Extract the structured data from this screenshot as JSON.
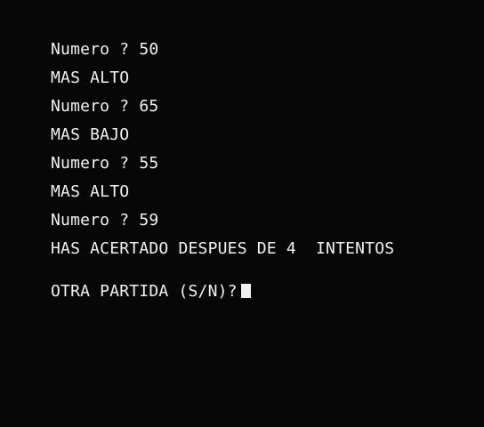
{
  "terminal": {
    "lines": [
      "Numero ? 50",
      "MAS ALTO",
      "Numero ? 65",
      "MAS BAJO",
      "Numero ? 55",
      "MAS ALTO",
      "Numero ? 59",
      "HAS ACERTADO DESPUES DE 4  INTENTOS"
    ],
    "prompt": "OTRA PARTIDA (S/N)?"
  },
  "colors": {
    "background": "#070707",
    "text": "#f2f2f2"
  }
}
